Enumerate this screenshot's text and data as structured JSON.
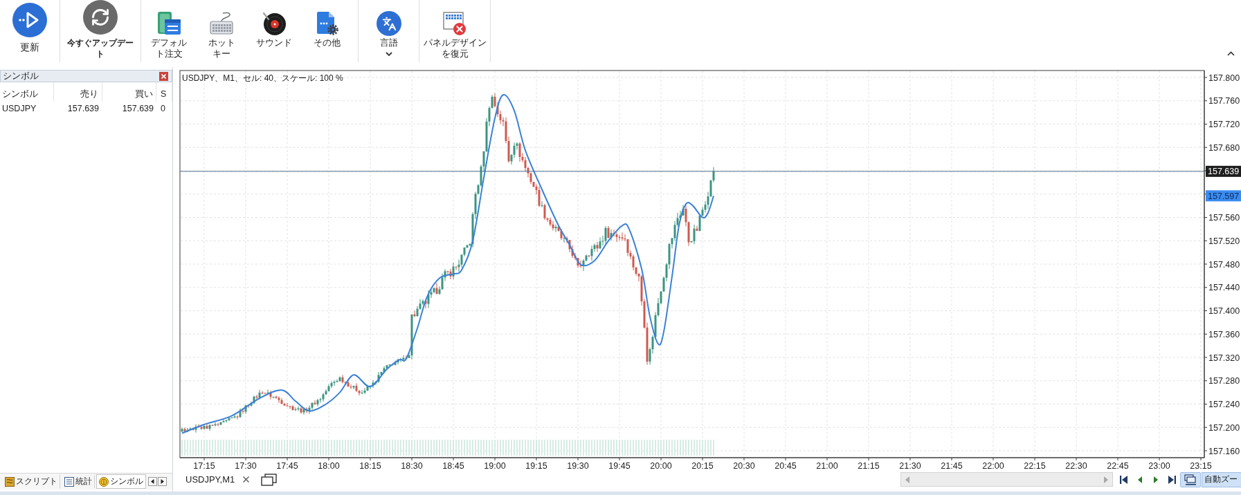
{
  "toolbar": {
    "groups": [
      {
        "buttons": [
          {
            "kind": "refresh",
            "label": "更新"
          }
        ]
      },
      {
        "buttons": [
          {
            "kind": "update",
            "label": "今すぐアップデート"
          }
        ]
      },
      {
        "buttons": [
          {
            "kind": "default_order",
            "label": "デフォルト注文"
          },
          {
            "kind": "hotkey",
            "label": "ホットキー"
          },
          {
            "kind": "sound",
            "label": "サウンド"
          },
          {
            "kind": "other",
            "label": "その他"
          }
        ]
      },
      {
        "buttons": [
          {
            "kind": "language",
            "label": "言語"
          }
        ]
      },
      {
        "buttons": [
          {
            "kind": "restore_layout",
            "label": "パネルデザインを復元"
          }
        ]
      }
    ]
  },
  "symbol_panel": {
    "title": "シンボル",
    "columns": [
      "シンボル",
      "売り",
      "買い",
      "S"
    ],
    "rows": [
      [
        "USDJPY",
        "157.639",
        "157.639",
        "0"
      ]
    ],
    "tabs": [
      {
        "kind": "script",
        "label": "スクリプト",
        "selected": false
      },
      {
        "kind": "stats",
        "label": "統計",
        "selected": false
      },
      {
        "kind": "symbols",
        "label": "シンボル",
        "selected": true
      }
    ]
  },
  "chart": {
    "title": "USDJPY、M1、セル: 40、スケール: 100 %",
    "price_labels": [
      "157.800",
      "157.760",
      "157.720",
      "157.680",
      "157.560",
      "157.520",
      "157.480",
      "157.440",
      "157.400",
      "157.360",
      "157.320",
      "157.280",
      "157.240",
      "157.200",
      "157.160"
    ],
    "price_markers": [
      {
        "kind": "last_price",
        "label": "157.639"
      },
      {
        "kind": "indicator",
        "label": "157.597"
      }
    ],
    "time_labels": [
      "17:15",
      "17:30",
      "17:45",
      "18:00",
      "18:15",
      "18:30",
      "18:45",
      "19:00",
      "19:15",
      "19:30",
      "19:45",
      "20:00",
      "20:15",
      "20:30",
      "20:45",
      "21:00",
      "21:15",
      "21:30",
      "21:45",
      "22:00",
      "22:15",
      "22:30",
      "22:45",
      "23:00",
      "23:15"
    ]
  },
  "chart_tab": {
    "label": "USDJPY,M1"
  },
  "zoom_button": {
    "label": "自動ズー"
  }
}
